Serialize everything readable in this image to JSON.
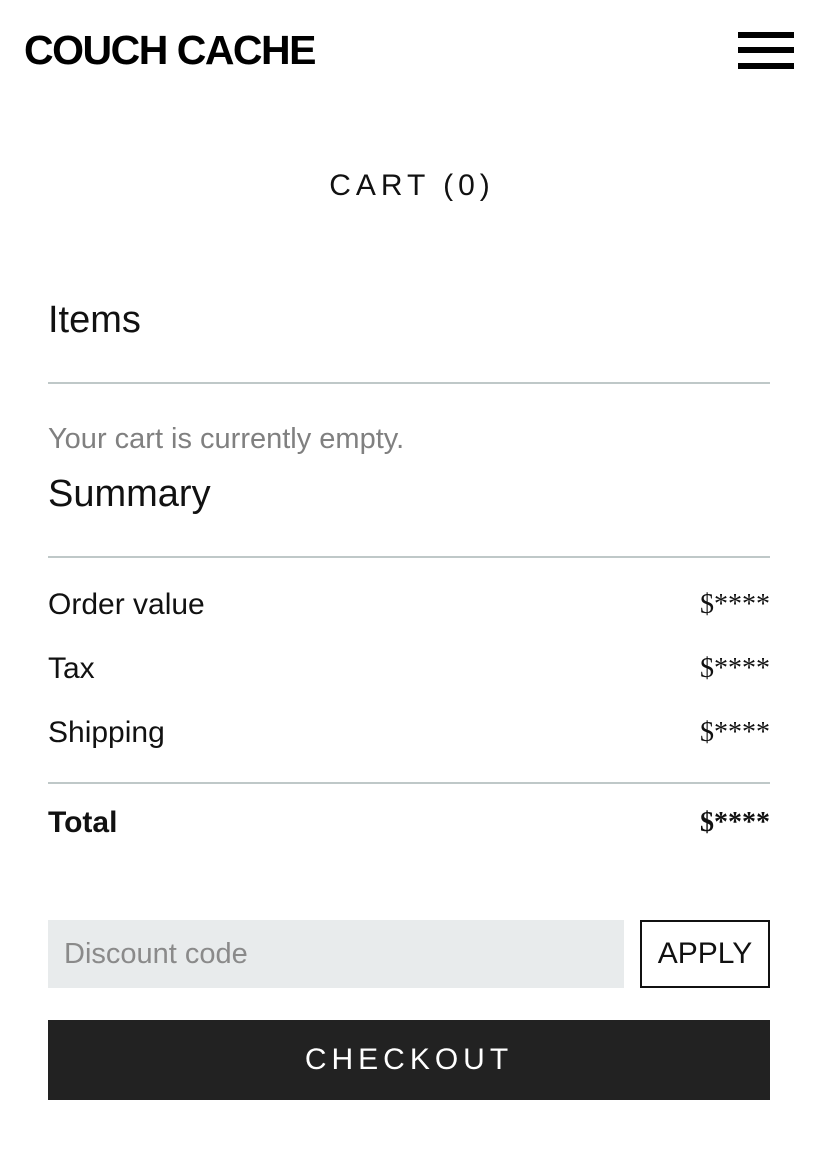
{
  "header": {
    "logo": "COUCH CACHE",
    "menu_icon": "hamburger-menu-icon"
  },
  "cart": {
    "title": "CART (0)"
  },
  "items": {
    "heading": "Items",
    "empty_message": "Your cart is currently empty."
  },
  "summary": {
    "heading": "Summary",
    "rows": [
      {
        "label": "Order value",
        "value": "$****"
      },
      {
        "label": "Tax",
        "value": "$****"
      },
      {
        "label": "Shipping",
        "value": "$****"
      }
    ],
    "total": {
      "label": "Total",
      "value": "$****"
    }
  },
  "discount": {
    "placeholder": "Discount code",
    "value": "",
    "apply_label": "APPLY"
  },
  "checkout": {
    "label": "CHECKOUT"
  },
  "colors": {
    "checkout_bg": "#222222",
    "input_bg": "#e8ebec",
    "divider": "#bfc8c8",
    "muted_text": "#808080"
  }
}
